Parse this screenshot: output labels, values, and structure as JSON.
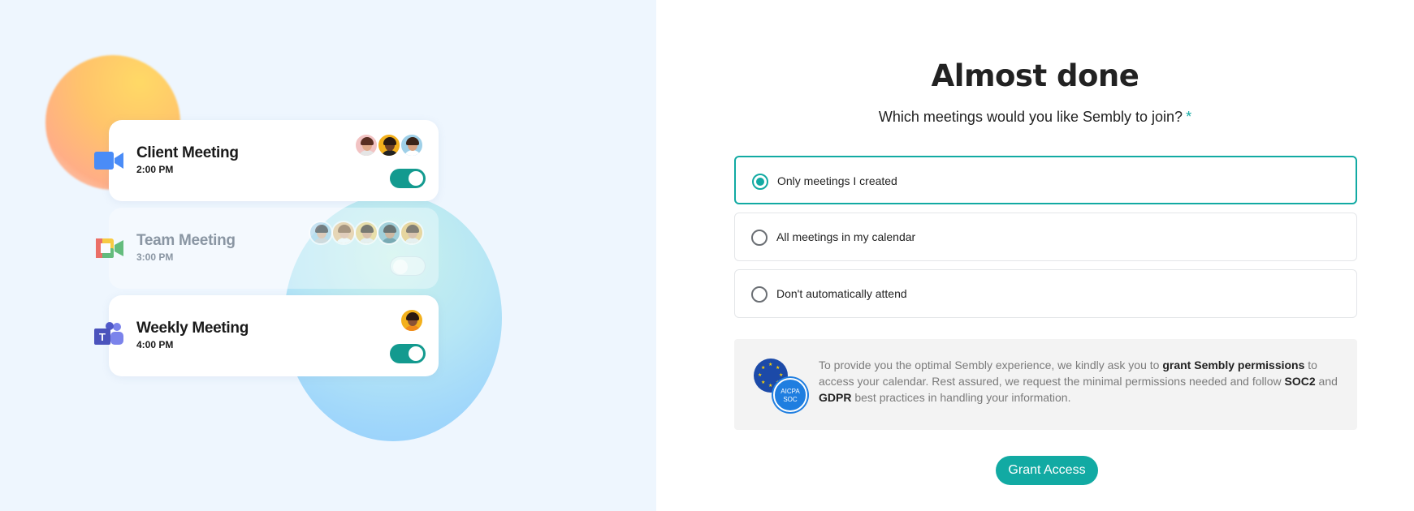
{
  "meetings": [
    {
      "title": "Client Meeting",
      "time": "2:00 PM",
      "app": "zoom-icon",
      "enabled": true,
      "attendees": 3
    },
    {
      "title": "Team Meeting",
      "time": "3:00 PM",
      "app": "google-meet-icon",
      "enabled": false,
      "attendees": 5
    },
    {
      "title": "Weekly Meeting",
      "time": "4:00 PM",
      "app": "microsoft-teams-icon",
      "enabled": true,
      "attendees": 1
    }
  ],
  "main": {
    "title": "Almost done",
    "question": "Which meetings would you like Sembly to join?",
    "required_marker": "*",
    "options": [
      {
        "label": "Only meetings I created",
        "selected": true
      },
      {
        "label": "All meetings in my calendar",
        "selected": false
      },
      {
        "label": "Don't automatically attend",
        "selected": false
      }
    ],
    "info": {
      "part1": "To provide you the optimal Sembly experience, we kindly ask you to ",
      "bold1": "grant Sembly permissions",
      "part2": " to access your calendar. Rest assured, we request the minimal permissions needed and follow ",
      "bold2": "SOC2",
      "part3": " and ",
      "bold3": "GDPR",
      "part4": " best practices in handling your information.",
      "badge_soc_line1": "AICPA",
      "badge_soc_line2": "SOC"
    },
    "grant_button": "Grant Access"
  },
  "colors": {
    "accent": "#12aaa3",
    "toggle_on": "#139a8f",
    "left_bg": "#eef6fe"
  }
}
